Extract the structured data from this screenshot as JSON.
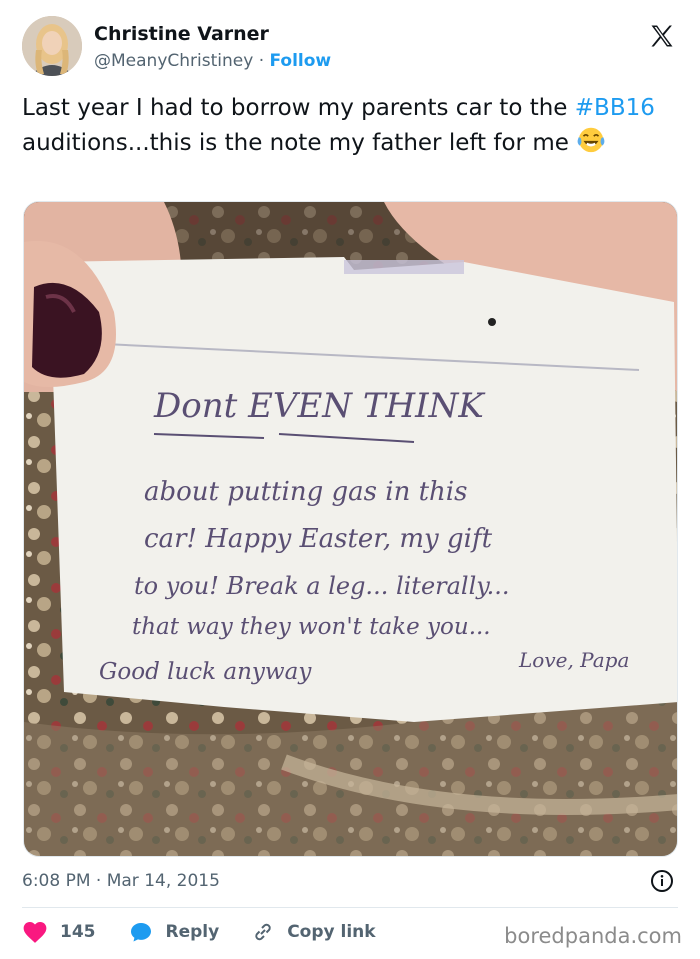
{
  "author": {
    "name": "Christine Varner",
    "handle": "@MeanyChristiney",
    "separator": "·",
    "follow_label": "Follow"
  },
  "tweet": {
    "text_before": "Last year I had to borrow my parents car to the ",
    "hashtag": "#BB16",
    "text_after": " auditions...this is the note my father left for me ",
    "emoji": "face-with-tears-of-joy-icon"
  },
  "photo": {
    "note_lines": [
      "Dont EVEN THINK",
      "about putting gas in this",
      "car!  Happy Easter, my gift",
      "to you! Break a leg... literally...",
      "that way they won't take you...",
      "Good luck anyway",
      "Love, Papa"
    ]
  },
  "meta": {
    "time": "6:08 PM",
    "separator": "·",
    "date": "Mar 14, 2015"
  },
  "actions": {
    "like_count": "145",
    "reply_label": "Reply",
    "copy_label": "Copy link"
  },
  "watermark": "boredpanda.com",
  "colors": {
    "accent": "#1d9bf0",
    "like": "#f91880",
    "text": "#0f1419",
    "muted": "#536471"
  }
}
